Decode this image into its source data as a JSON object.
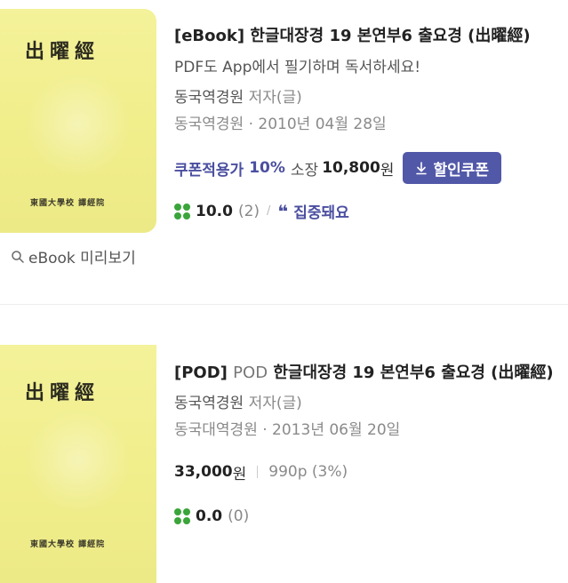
{
  "items": [
    {
      "cover_title": "出曜經",
      "cover_publisher": "東國大學校 譯經院",
      "preview_label": "eBook 미리보기",
      "tag": "[eBook]",
      "title": "한글대장경 19 본연부6 출요경 (出曜經)",
      "subcopy": "PDF도 App에서 필기하며 독서하세요!",
      "author": "동국역경원",
      "author_role": "저자(글)",
      "publisher_date": "동국역경원 · 2010년 04월 28일",
      "coupon_label": "쿠폰적용가",
      "coupon_pct": "10%",
      "own_label": "소장",
      "price": "10,800",
      "won": "원",
      "coupon_button": "할인쿠폰",
      "rating": "10.0",
      "rating_count": "(2)",
      "slash": "/",
      "focus_label": "집중돼요"
    },
    {
      "cover_title": "出曜經",
      "cover_publisher": "東國大學校 譯經院",
      "tag": "[POD]",
      "pod_label": "POD",
      "title": "한글대장경 19 본연부6 출요경 (出曜經)",
      "author": "동국역경원",
      "author_role": "저자(글)",
      "publisher_date": "동국대역경원 · 2013년 06월 20일",
      "price": "33,000",
      "won": "원",
      "pages": "990p (3%)",
      "rating": "0.0",
      "rating_count": "(0)"
    }
  ],
  "colors": {
    "accent": "#4b4fa0",
    "button": "#5258a8",
    "clover": "#3aa53a",
    "cover": "#f1ee8c"
  },
  "icons": [
    "search-icon",
    "download-icon",
    "clover-icon",
    "quote-icon"
  ]
}
